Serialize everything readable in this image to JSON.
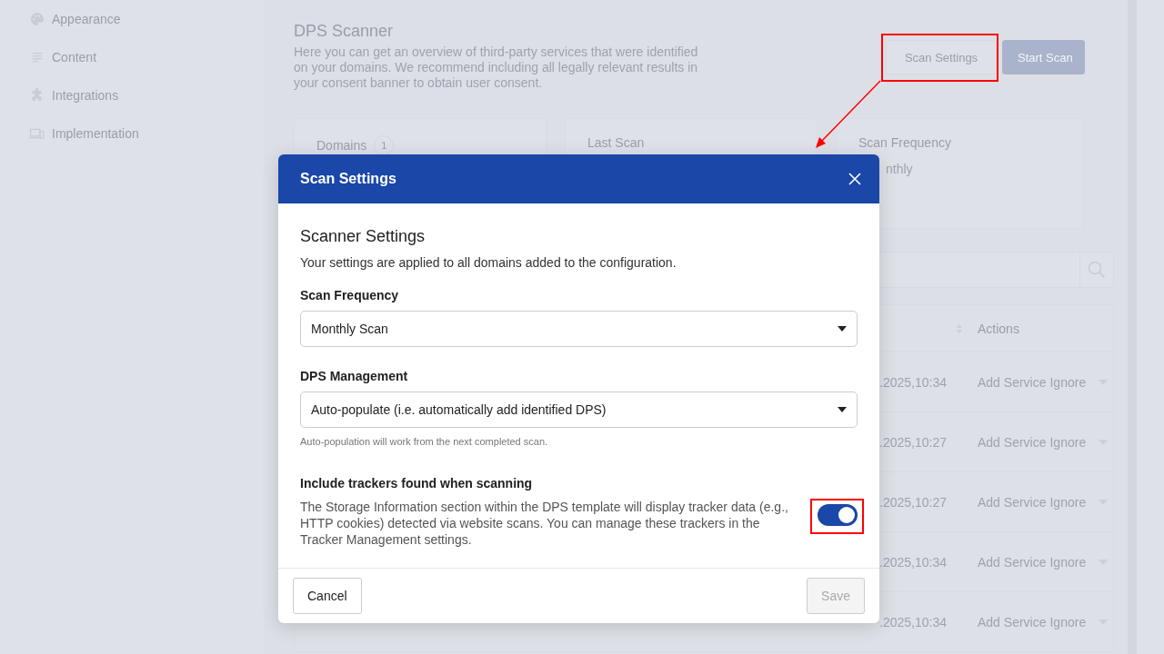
{
  "sidebar": {
    "items": [
      {
        "label": "Appearance"
      },
      {
        "label": "Content"
      },
      {
        "label": "Integrations"
      },
      {
        "label": "Implementation"
      }
    ]
  },
  "page": {
    "title": "DPS Scanner",
    "description": "Here you can get an overview of third-party services that were identified on your domains. We recommend including all legally relevant results in your consent banner to obtain user consent.",
    "buttons": [
      {
        "label": "Scan Settings",
        "kind": "secondary"
      },
      {
        "label": "Start Scan",
        "kind": "primary"
      }
    ]
  },
  "stats": [
    {
      "label": "Domains",
      "count": "1"
    },
    {
      "label": "Last Scan"
    },
    {
      "label": "Scan Frequency",
      "value": "nthly"
    }
  ],
  "table": {
    "columns": [
      {
        "label": "Actions"
      }
    ],
    "rows": [
      {
        "time": ".2025,10:34",
        "actions": [
          "Add Service",
          "Ignore"
        ]
      },
      {
        "time": ".2025,10:27",
        "actions": [
          "Add Service",
          "Ignore"
        ]
      },
      {
        "time": ".2025,10:27",
        "actions": [
          "Add Service",
          "Ignore"
        ]
      },
      {
        "time": ".2025,10:34",
        "actions": [
          "Add Service",
          "Ignore"
        ]
      },
      {
        "time": ".2025,10:34",
        "actions": [
          "Add Service",
          "Ignore"
        ]
      }
    ]
  },
  "dialog": {
    "title": "Scan Settings",
    "heading": "Scanner Settings",
    "subtitle": "Your settings are applied to all domains added to the configuration.",
    "fields": [
      {
        "label": "Scan Frequency",
        "value": "Monthly Scan"
      },
      {
        "label": "DPS Management",
        "value": "Auto-populate (i.e. automatically add identified DPS)",
        "hint": "Auto-population will work from the next completed scan."
      }
    ],
    "toggle": {
      "label": "Include trackers found when scanning",
      "description": "The Storage Information section within the DPS template will display tracker data (e.g., HTTP cookies) detected via website scans. You can manage these trackers in the Tracker Management settings.",
      "on": true
    },
    "buttons": [
      {
        "label": "Cancel",
        "disabled": false
      },
      {
        "label": "Save",
        "disabled": true
      }
    ]
  }
}
